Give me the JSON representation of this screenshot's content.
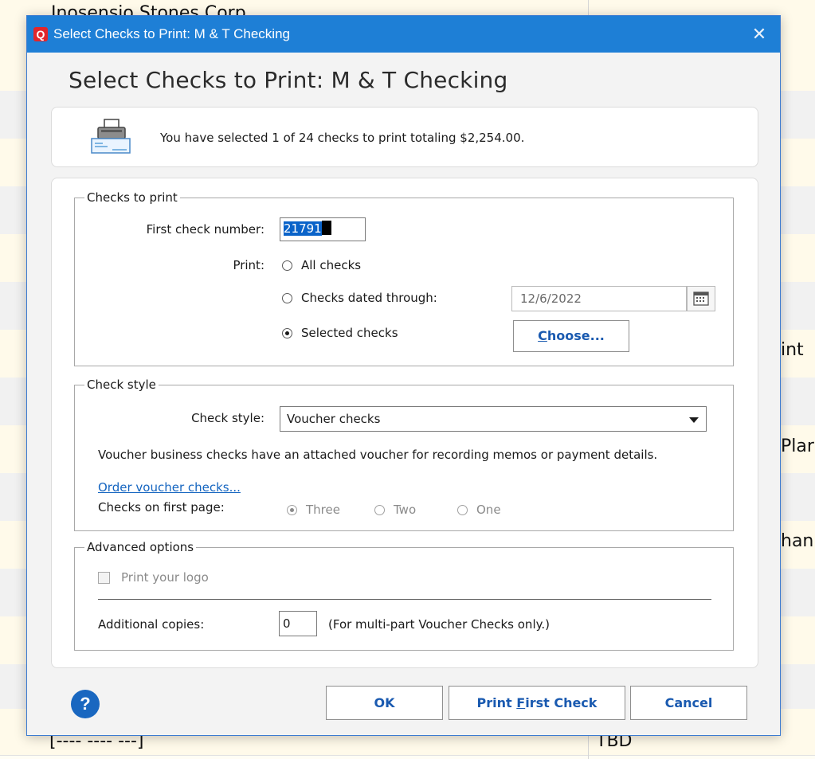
{
  "background": {
    "company_name": "Inosensio Stones Corp",
    "partial_right_texts": [
      "int",
      "Plar",
      "han"
    ],
    "bottom_left_text": "[---- ---- ---]",
    "bottom_right_text": "TBD"
  },
  "dialog": {
    "app_icon_letter": "Q",
    "window_title": "Select Checks to Print: M & T Checking",
    "close_glyph": "✕",
    "heading": "Select Checks to Print: M & T Checking",
    "summary_text": "You have selected 1 of 24 checks to print totaling $2,254.00.",
    "checks_to_print": {
      "legend": "Checks to print",
      "first_check_label": "First check number:",
      "first_check_value": "21791",
      "print_label": "Print:",
      "options": [
        {
          "label": "All checks",
          "checked": false
        },
        {
          "label": "Checks dated through:",
          "checked": false
        },
        {
          "label": "Selected checks",
          "checked": true
        }
      ],
      "date_value": "12/6/2022",
      "choose_button_prefix": "C",
      "choose_button_rest": "hoose..."
    },
    "check_style": {
      "legend": "Check style",
      "style_label": "Check style:",
      "style_value": "Voucher checks",
      "description": "Voucher business checks have an attached voucher for recording memos or payment details.",
      "order_link": "Order voucher checks...",
      "first_page_label": "Checks on first page:",
      "first_page_options": [
        {
          "label": "Three",
          "checked": true
        },
        {
          "label": "Two",
          "checked": false
        },
        {
          "label": "One",
          "checked": false
        }
      ]
    },
    "advanced": {
      "legend": "Advanced options",
      "print_logo_label": "Print your logo",
      "copies_label": "Additional copies:",
      "copies_value": "0",
      "copies_note": "(For multi-part Voucher Checks only.)"
    },
    "buttons": {
      "help": "?",
      "ok": "OK",
      "print_first_prefix": "Print ",
      "print_first_accel": "F",
      "print_first_rest": "irst Check",
      "cancel": "Cancel"
    }
  },
  "colors": {
    "titlebar": "#1e7fd6",
    "button_text": "#1a5ab0",
    "link": "#1565c0",
    "selection": "#0a63c9"
  }
}
